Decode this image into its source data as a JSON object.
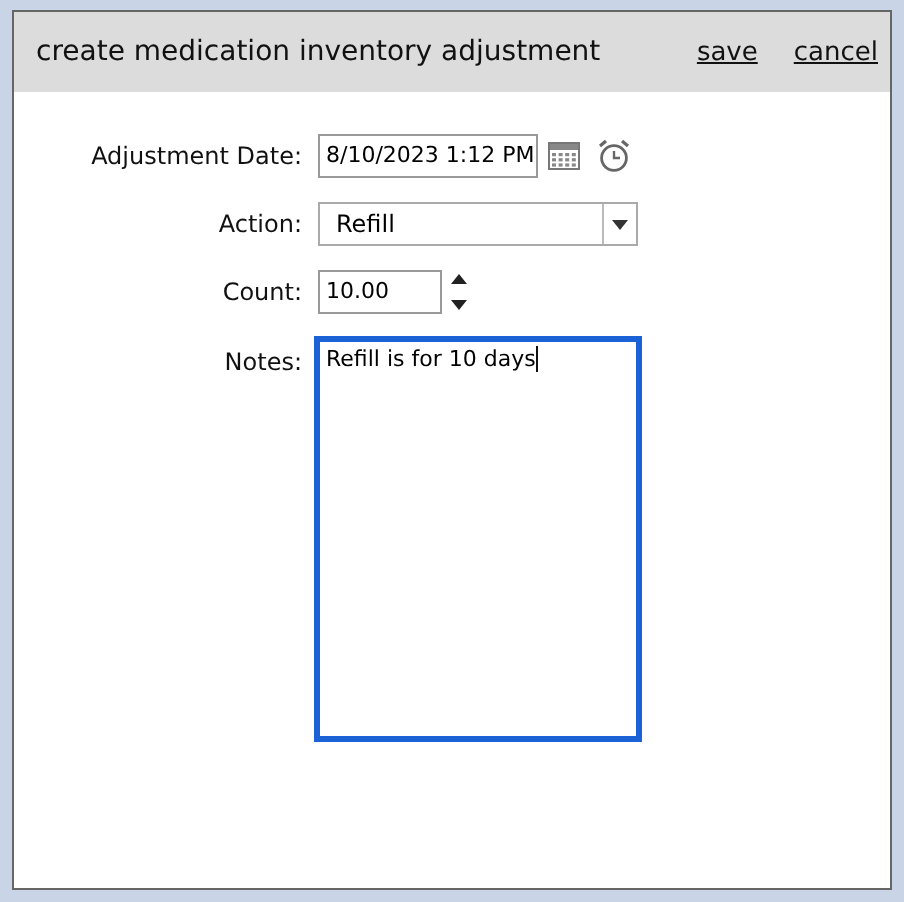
{
  "dialog": {
    "title": "create medication inventory adjustment",
    "actions": [
      "save",
      "cancel"
    ]
  },
  "fields": [
    {
      "kind": "datetime",
      "label": "Adjustment Date:",
      "value": "8/10/2023 1:12 PM"
    },
    {
      "kind": "select",
      "label": "Action:",
      "value": "Refill"
    },
    {
      "kind": "spinner",
      "label": "Count:",
      "value": "10.00"
    },
    {
      "kind": "textarea",
      "label": "Notes:",
      "value": "Refill is for 10 days",
      "focused": true
    }
  ]
}
